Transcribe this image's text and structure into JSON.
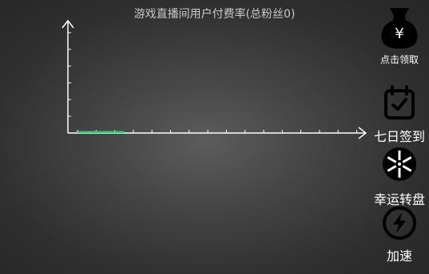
{
  "chart_data": {
    "type": "bar",
    "title": "游戏直播间用户付费率(总粉丝0)",
    "xlabel": "",
    "ylabel": "",
    "x_tick_count": 16,
    "y_tick_count": 6,
    "series": [
      {
        "values": [
          0
        ]
      }
    ],
    "colors": {
      "axis": "#ffffff",
      "bar": "#2ecc71",
      "title": "#c8c8c8"
    }
  },
  "sidebar": {
    "reward": {
      "label": "点击领取",
      "icon": "money-bag-icon",
      "glyph": "¥"
    },
    "checkin": {
      "label": "七日签到",
      "icon": "calendar-check-icon"
    },
    "wheel": {
      "label": "幸运转盘",
      "icon": "lucky-wheel-icon"
    },
    "speed": {
      "label": "加速",
      "icon": "lightning-icon"
    }
  }
}
